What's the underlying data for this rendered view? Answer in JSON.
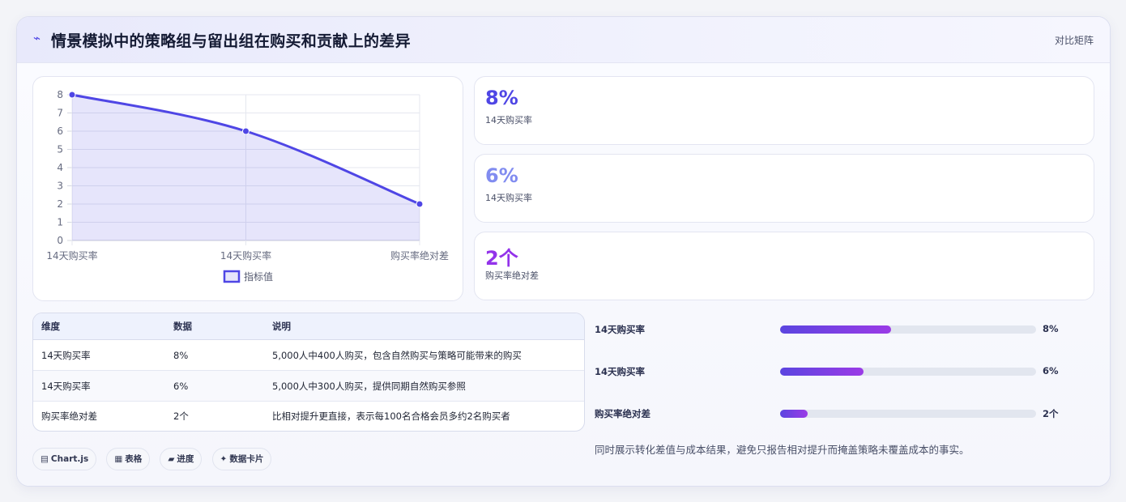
{
  "header": {
    "icon": "chart-line-icon",
    "title": "情景模拟中的策略组与留出组在购买和贡献上的差异",
    "tag": "对比矩阵"
  },
  "chart_data": {
    "type": "area",
    "categories": [
      "14天购买率",
      "14天购买率",
      "购买率绝对差"
    ],
    "series": [
      {
        "name": "指标值",
        "values": [
          8,
          6,
          2
        ],
        "color": "#4f46e5"
      }
    ],
    "ylim": [
      0,
      8
    ],
    "yticks": [
      0,
      1,
      2,
      3,
      4,
      5,
      6,
      7,
      8
    ],
    "grid": true,
    "legend": "bottom"
  },
  "stats": [
    {
      "value": "8%",
      "label": "14天购买率",
      "color": "#4f46e5"
    },
    {
      "value": "6%",
      "label": "14天购买率",
      "color": "#818cf0"
    },
    {
      "value": "2个",
      "label": "购买率绝对差",
      "color": "#9333ea"
    }
  ],
  "table": {
    "headers": [
      "维度",
      "数据",
      "说明"
    ],
    "rows": [
      [
        "14天购买率",
        "8%",
        "5,000人中400人购买，包含自然购买与策略可能带来的购买"
      ],
      [
        "14天购买率",
        "6%",
        "5,000人中300人购买，提供同期自然购买参照"
      ],
      [
        "购买率绝对差",
        "2个",
        "比相对提升更直接，表示每100名合格会员多约2名购买者"
      ]
    ]
  },
  "progress": [
    {
      "label": "14天购买率",
      "value": "8%",
      "fraction": 0.435
    },
    {
      "label": "14天购买率",
      "value": "6%",
      "fraction": 0.326
    },
    {
      "label": "购买率绝对差",
      "value": "2个",
      "fraction": 0.109
    }
  ],
  "note": "同时展示转化差值与成本结果，避免只报告相对提升而掩盖策略未覆盖成本的事实。",
  "chips": [
    {
      "icon": "▤",
      "label": "Chart.js"
    },
    {
      "icon": "▦",
      "label": "表格"
    },
    {
      "icon": "▰",
      "label": "进度"
    },
    {
      "icon": "✦",
      "label": "数据卡片"
    }
  ]
}
